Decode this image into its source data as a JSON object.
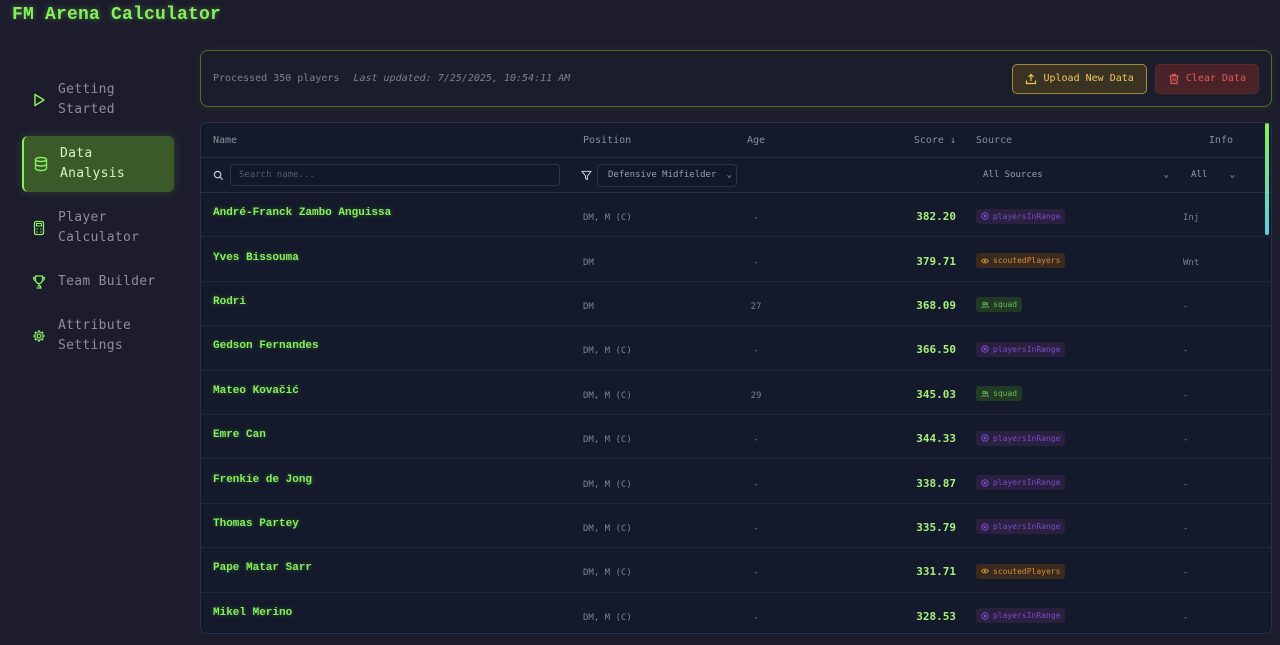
{
  "app": {
    "title": "FM Arena Calculator"
  },
  "sidebar": {
    "items": [
      {
        "label": "Getting\nStarted",
        "icon": "play-icon",
        "active": false
      },
      {
        "label": "Data\nAnalysis",
        "icon": "database-icon",
        "active": true
      },
      {
        "label": "Player\nCalculator",
        "icon": "calculator-icon",
        "active": false
      },
      {
        "label": "Team Builder",
        "icon": "trophy-icon",
        "active": false
      },
      {
        "label": "Attribute\nSettings",
        "icon": "gear-icon",
        "active": false
      }
    ]
  },
  "status": {
    "processed": "Processed 350 players",
    "updated": "Last updated: 7/25/2025, 10:54:11 AM",
    "upload_label": "Upload New Data",
    "clear_label": "Clear Data"
  },
  "table": {
    "headers": {
      "name": "Name",
      "position": "Position",
      "age": "Age",
      "score": "Score ↓",
      "source": "Source",
      "info": "Info"
    },
    "filters": {
      "search_placeholder": "Search name...",
      "position_value": "Defensive Midfielder",
      "source_value": "All Sources",
      "info_value": "All"
    },
    "rows": [
      {
        "name": "André-Franck Zambo Anguissa",
        "position": "DM, M (C)",
        "age": "-",
        "score": "382.20",
        "source": "playersInRange",
        "source_type": "range",
        "info": "Inj"
      },
      {
        "name": "Yves Bissouma",
        "position": "DM",
        "age": "-",
        "score": "379.71",
        "source": "scoutedPlayers",
        "source_type": "scouted",
        "info": "Wnt"
      },
      {
        "name": "Rodri",
        "position": "DM",
        "age": "27",
        "score": "368.09",
        "source": "squad",
        "source_type": "squad",
        "info": "-"
      },
      {
        "name": "Gedson Fernandes",
        "position": "DM, M (C)",
        "age": "-",
        "score": "366.50",
        "source": "playersInRange",
        "source_type": "range",
        "info": "-"
      },
      {
        "name": "Mateo Kovačić",
        "position": "DM, M (C)",
        "age": "29",
        "score": "345.03",
        "source": "squad",
        "source_type": "squad",
        "info": "-"
      },
      {
        "name": "Emre Can",
        "position": "DM, M (C)",
        "age": "-",
        "score": "344.33",
        "source": "playersInRange",
        "source_type": "range",
        "info": "-"
      },
      {
        "name": "Frenkie de Jong",
        "position": "DM, M (C)",
        "age": "-",
        "score": "338.87",
        "source": "playersInRange",
        "source_type": "range",
        "info": "-"
      },
      {
        "name": "Thomas Partey",
        "position": "DM, M (C)",
        "age": "-",
        "score": "335.79",
        "source": "playersInRange",
        "source_type": "range",
        "info": "-"
      },
      {
        "name": "Pape Matar Sarr",
        "position": "DM, M (C)",
        "age": "-",
        "score": "331.71",
        "source": "scoutedPlayers",
        "source_type": "scouted",
        "info": "-"
      },
      {
        "name": "Mikel Merino",
        "position": "DM, M (C)",
        "age": "-",
        "score": "328.53",
        "source": "playersInRange",
        "source_type": "range",
        "info": "-"
      }
    ]
  },
  "colors": {
    "accent": "#86f05a",
    "background": "#1c1c2c",
    "upload": "#f0c65a",
    "clear": "#e0585e"
  }
}
